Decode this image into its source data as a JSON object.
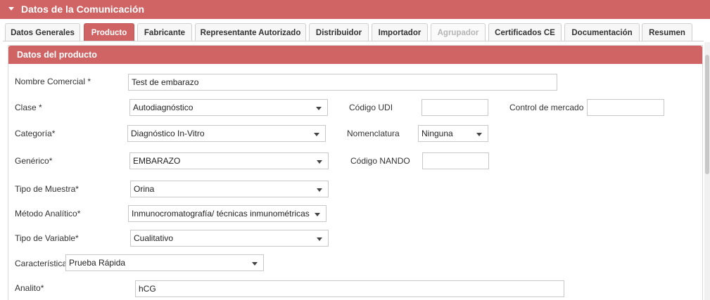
{
  "header": {
    "title": "Datos de la Comunicación"
  },
  "tabs": [
    {
      "label": "Datos Generales",
      "state": "normal"
    },
    {
      "label": "Producto",
      "state": "active"
    },
    {
      "label": "Fabricante",
      "state": "normal"
    },
    {
      "label": "Representante Autorizado",
      "state": "normal"
    },
    {
      "label": "Distribuidor",
      "state": "normal"
    },
    {
      "label": "Importador",
      "state": "normal"
    },
    {
      "label": "Agrupador",
      "state": "disabled"
    },
    {
      "label": "Certificados CE",
      "state": "normal"
    },
    {
      "label": "Documentación",
      "state": "normal"
    },
    {
      "label": "Resumen",
      "state": "normal"
    }
  ],
  "panel": {
    "title": "Datos del producto"
  },
  "form": {
    "nombre_comercial": {
      "label": "Nombre Comercial *",
      "value": "Test de embarazo"
    },
    "clase": {
      "label": "Clase *",
      "value": "Autodiagnóstico"
    },
    "codigo_udi": {
      "label": "Código UDI",
      "value": ""
    },
    "control_mercado": {
      "label": "Control de mercado",
      "value": ""
    },
    "categoria": {
      "label": "Categoría*",
      "value": "Diagnóstico In-Vitro"
    },
    "nomenclatura": {
      "label": "Nomenclatura",
      "value": "Ninguna"
    },
    "generico": {
      "label": "Genérico*",
      "value": "EMBARAZO"
    },
    "codigo_nando": {
      "label": "Código NANDO",
      "value": ""
    },
    "tipo_muestra": {
      "label": "Tipo de Muestra*",
      "value": "Orina"
    },
    "metodo_analitico": {
      "label": "Método Analítico*",
      "value": "Inmunocromatografía/ técnicas inmunométricas"
    },
    "tipo_variable": {
      "label": "Tipo de Variable*",
      "value": "Cualitativo"
    },
    "caracteristica": {
      "label": "Característica",
      "value": "Prueba Rápida"
    },
    "analito": {
      "label": "Analito*",
      "value": "hCG"
    }
  },
  "colors": {
    "accent": "#d06464"
  },
  "icons": {
    "collapse": "caret-down-icon",
    "dropdown": "chevron-down-icon"
  }
}
